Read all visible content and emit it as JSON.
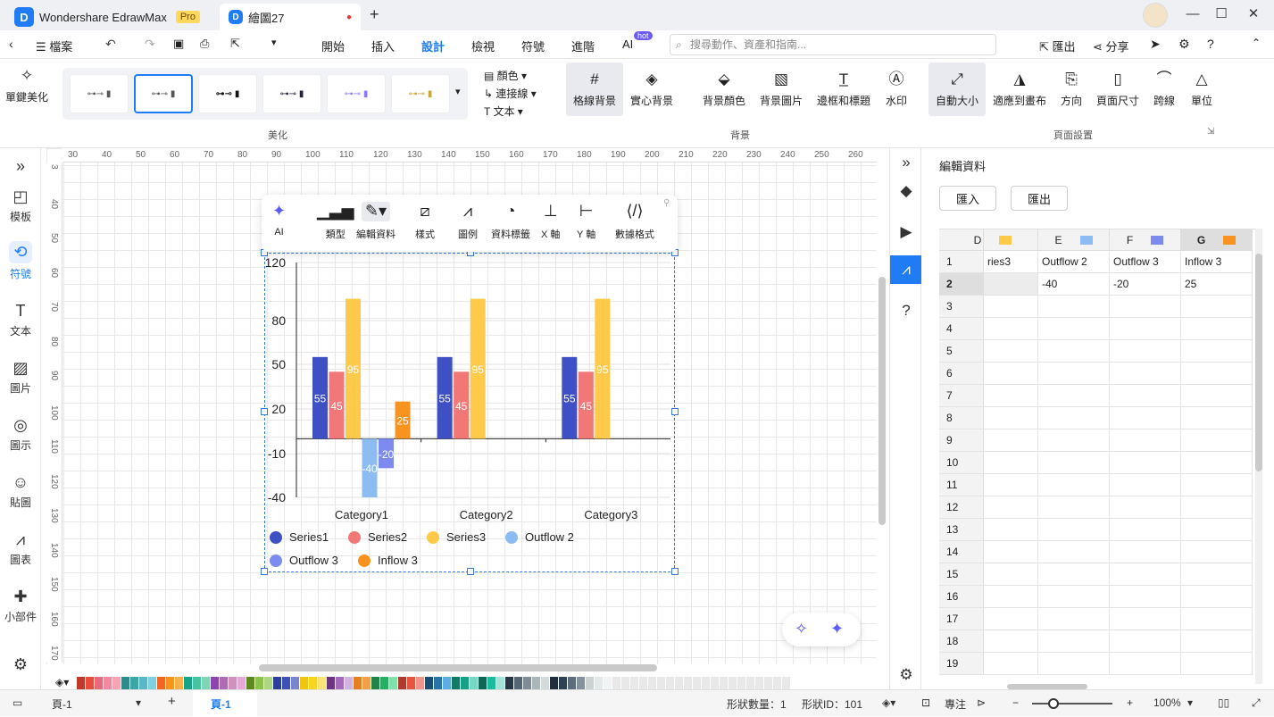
{
  "titlebar": {
    "app_name": "Wondershare EdrawMax",
    "pro_badge": "Pro",
    "doc_tab": "繪圖27",
    "add_tab": "+"
  },
  "menubar": {
    "file": "檔案",
    "items": [
      "開始",
      "插入",
      "設計",
      "檢視",
      "符號",
      "進階",
      "AI"
    ],
    "active": "設計",
    "ai_badge": "hot",
    "search_placeholder": "搜尋動作、資產和指南...",
    "export": "匯出",
    "share": "分享"
  },
  "ribbon": {
    "one_click": "單鍵美化",
    "color": "顏色",
    "connector": "連接線",
    "text": "文本",
    "group_beautify": "美化",
    "grid_bg": "格線背景",
    "solid_bg": "實心背景",
    "bg_color": "背景顏色",
    "bg_image": "背景圖片",
    "border_title": "邊框和標題",
    "watermark": "水印",
    "group_background": "背景",
    "auto_size": "自動大小",
    "fit_canvas": "適應到畫布",
    "orientation": "方向",
    "page_size": "頁面尺寸",
    "jump_line": "跨線",
    "unit": "單位",
    "group_page": "頁面設置"
  },
  "left_sidebar": [
    "模板",
    "符號",
    "文本",
    "圖片",
    "圖示",
    "貼圖",
    "圖表",
    "小部件"
  ],
  "ruler": {
    "h": [
      "30",
      "40",
      "50",
      "60",
      "70",
      "80",
      "90",
      "100",
      "110",
      "120",
      "130",
      "140",
      "150",
      "160",
      "170",
      "180",
      "190",
      "200",
      "210",
      "220",
      "230",
      "240",
      "250",
      "260"
    ],
    "v": [
      "3",
      "40",
      "50",
      "60",
      "70",
      "80",
      "90",
      "100",
      "110",
      "120",
      "130",
      "140",
      "150",
      "160",
      "170"
    ]
  },
  "floatbar": {
    "ai": "AI",
    "type": "類型",
    "edit_data": "編輯資料",
    "style": "樣式",
    "legend": "圖例",
    "data_label": "資料標籤",
    "x_axis": "X 軸",
    "y_axis": "Y 軸",
    "number_format": "數據格式"
  },
  "chart_data": {
    "type": "bar",
    "categories": [
      "Category1",
      "Category2",
      "Category3"
    ],
    "series": [
      {
        "name": "Series1",
        "values": [
          55,
          55,
          55
        ],
        "color": "#3f4fc4"
      },
      {
        "name": "Series2",
        "values": [
          45,
          45,
          45
        ],
        "color": "#f27777"
      },
      {
        "name": "Series3",
        "values": [
          95,
          95,
          95
        ],
        "color": "#ffc94a"
      },
      {
        "name": "Outflow 2",
        "values": [
          -40,
          null,
          null
        ],
        "color": "#8cbcf2"
      },
      {
        "name": "Outflow 3",
        "values": [
          -20,
          null,
          null
        ],
        "color": "#7d8bf0"
      },
      {
        "name": "Inflow 3",
        "values": [
          25,
          null,
          null
        ],
        "color": "#f7931e"
      }
    ],
    "y_ticks": [
      "120",
      "80",
      "50",
      "20",
      "-10",
      "-40"
    ],
    "ylim": [
      -40,
      120
    ],
    "legend_position": "bottom",
    "grid": true
  },
  "right_panel": {
    "title": "編輯資料",
    "import": "匯入",
    "export": "匯出",
    "columns": [
      {
        "letter": "D",
        "color": "#ffc94a"
      },
      {
        "letter": "E",
        "color": "#8cbcf2"
      },
      {
        "letter": "F",
        "color": "#7d8bf0"
      },
      {
        "letter": "G",
        "color": "#f7931e"
      }
    ],
    "row1": [
      "ries3",
      "Outflow 2",
      "Outflow 3",
      "Inflow 3"
    ],
    "row2": [
      "",
      "-40",
      "-20",
      "25"
    ],
    "row_numbers": [
      "1",
      "2",
      "3",
      "4",
      "5",
      "6",
      "7",
      "8",
      "9",
      "10",
      "11",
      "12",
      "13",
      "14",
      "15",
      "16",
      "17",
      "18",
      "19"
    ]
  },
  "statusbar": {
    "page_select": "頁-1",
    "page_tab": "頁-1",
    "shape_count": "形狀數量：1",
    "shape_id": "形狀ID：101",
    "focus": "專注",
    "zoom": "100%"
  }
}
